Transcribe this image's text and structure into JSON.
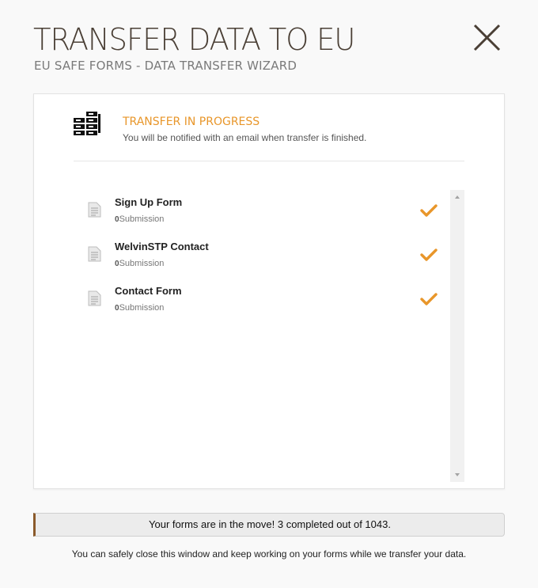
{
  "header": {
    "title": "TRANSFER DATA TO EU",
    "subtitle": "EU SAFE FORMS - DATA TRANSFER WIZARD"
  },
  "status": {
    "title": "TRANSFER IN PROGRESS",
    "description": "You will be notified with an email when transfer is finished.",
    "icon": "server-rack-icon"
  },
  "forms": [
    {
      "name": "Sign Up Form",
      "submissions": "0",
      "submissions_label": "Submission",
      "status": "completed"
    },
    {
      "name": "WelvinSTP Contact",
      "submissions": "0",
      "submissions_label": "Submission",
      "status": "completed"
    },
    {
      "name": "Contact Form",
      "submissions": "0",
      "submissions_label": "Submission",
      "status": "completed"
    }
  ],
  "progress": {
    "text": "Your forms are in the move! 3 completed out of 1043.",
    "completed": 3,
    "total": 1043
  },
  "footer_note": "You can safely close this window and keep working on your forms while we transfer your data.",
  "colors": {
    "accent": "#e8962a",
    "title": "#4a3f35",
    "progress_border": "#8b5a2b"
  }
}
